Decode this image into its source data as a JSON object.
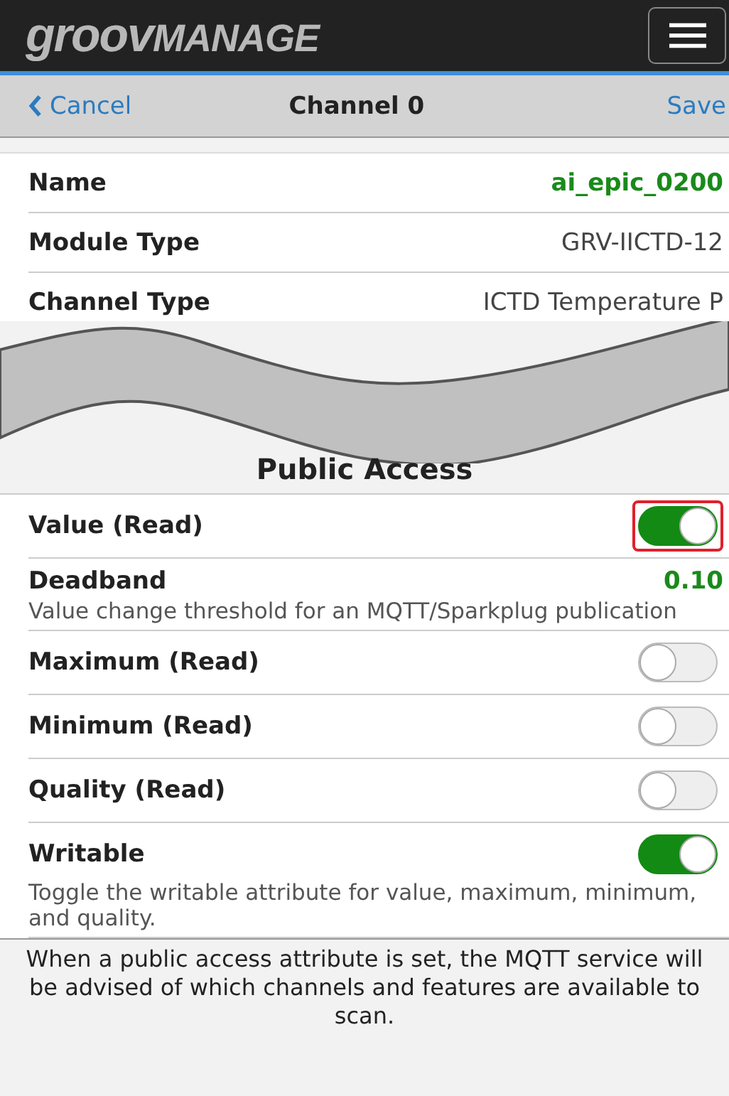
{
  "header": {
    "logo": [
      "groov",
      "MANAGE"
    ]
  },
  "nav": {
    "back": "Cancel",
    "title": "Channel 0",
    "action": "Save"
  },
  "details": [
    {
      "label": "Name",
      "value": "ai_epic_0200",
      "emphasis": true
    },
    {
      "label": "Module Type",
      "value": "GRV-IICTD-12",
      "emphasis": false
    },
    {
      "label": "Channel Type",
      "value": "ICTD Temperature P",
      "emphasis": false
    }
  ],
  "section_title": "Public Access",
  "settings": [
    {
      "kind": "toggle",
      "label": "Value (Read)",
      "on": true,
      "highlighted": true
    },
    {
      "kind": "value",
      "label": "Deadband",
      "value": "0.10",
      "description": "Value change threshold for an MQTT/Sparkplug publication"
    },
    {
      "kind": "toggle",
      "label": "Maximum (Read)",
      "on": false,
      "highlighted": false
    },
    {
      "kind": "toggle",
      "label": "Minimum (Read)",
      "on": false,
      "highlighted": false
    },
    {
      "kind": "toggle",
      "label": "Quality (Read)",
      "on": false,
      "highlighted": false
    },
    {
      "kind": "toggle",
      "label": "Writable",
      "on": true,
      "highlighted": false,
      "description": "Toggle the writable attribute for value, maximum, minimum, and quality."
    }
  ],
  "footer_note": "When a public access attribute is set, the MQTT service will be advised of which channels and features are available to scan."
}
